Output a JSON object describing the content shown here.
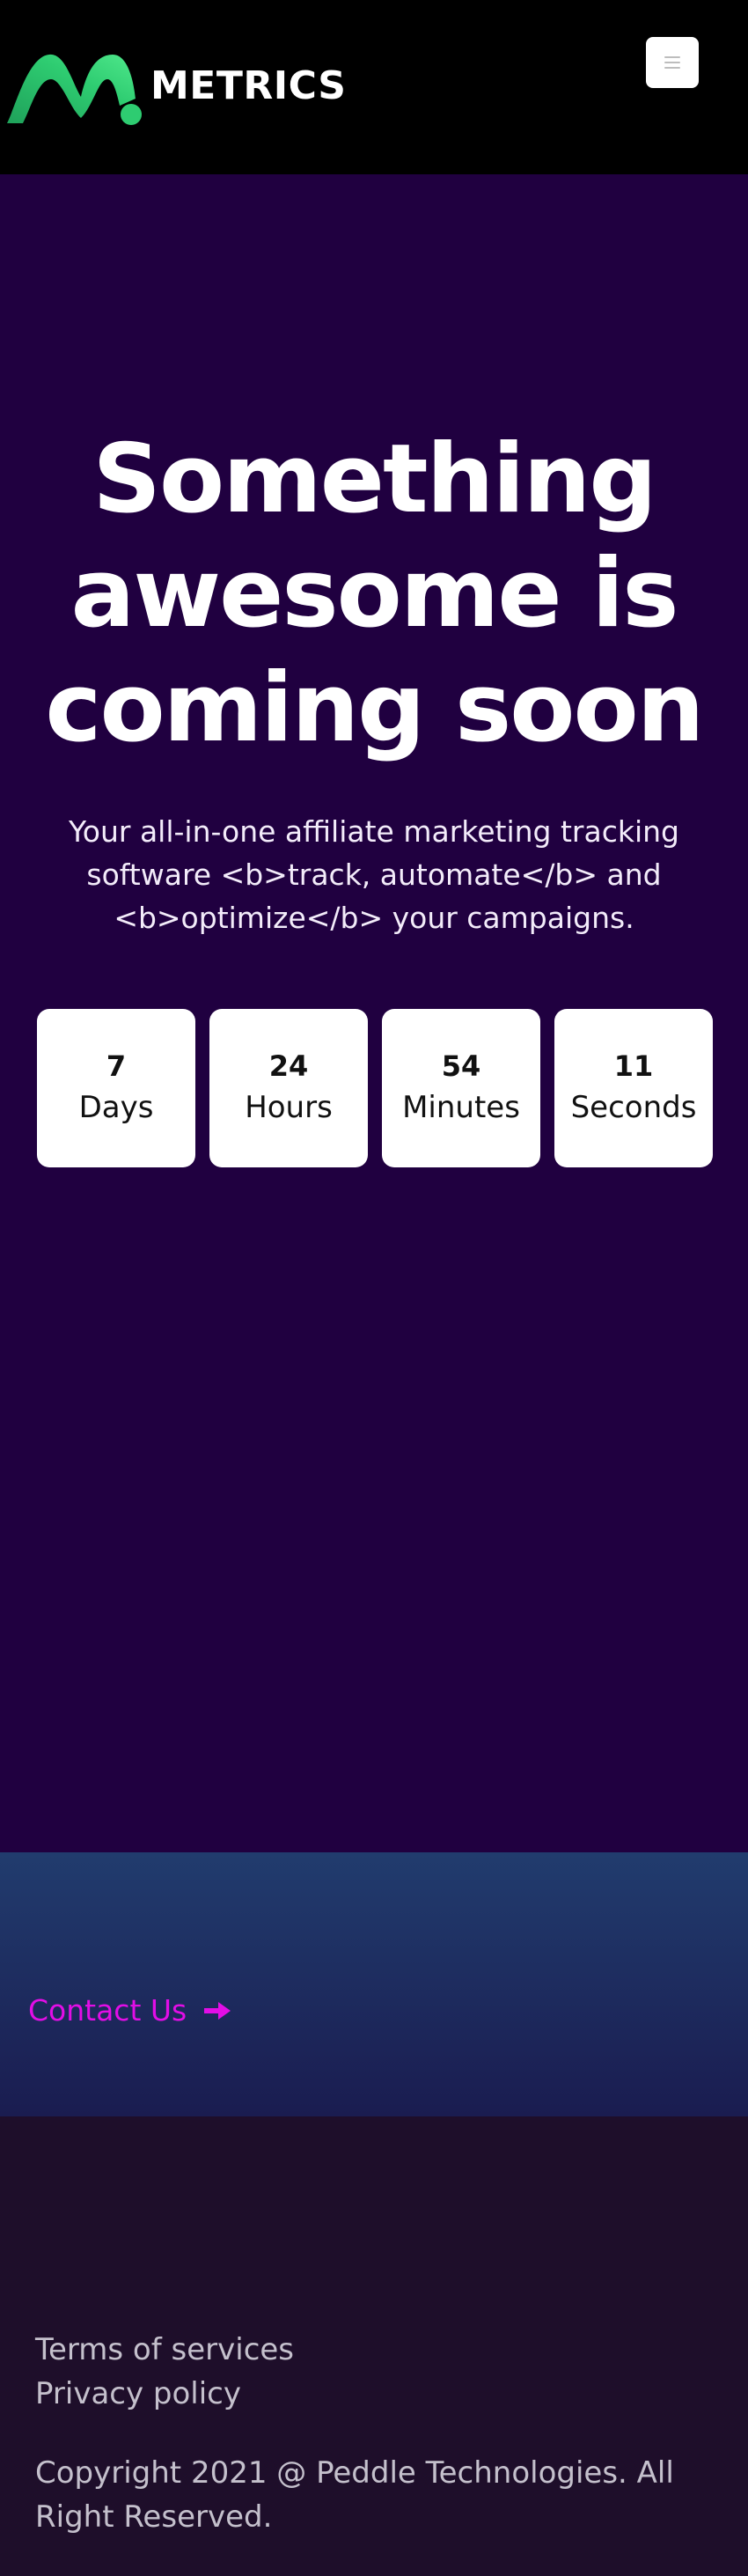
{
  "header": {
    "logo_text": "METRICS",
    "menu_icon": "hamburger-icon"
  },
  "hero": {
    "title": "Something awesome is coming soon",
    "subtitle": "Your all-in-one affiliate marketing tracking software <b>track, automate</b> and <b>optimize</b> your campaigns."
  },
  "countdown": [
    {
      "value": "7",
      "label": "Days"
    },
    {
      "value": "24",
      "label": "Hours"
    },
    {
      "value": "54",
      "label": "Minutes"
    },
    {
      "value": "11",
      "label": "Seconds"
    }
  ],
  "contact": {
    "label": "Contact Us",
    "icon": "arrow-right-icon",
    "color": "#e20ee6"
  },
  "footer": {
    "terms_label": "Terms of services",
    "privacy_label": "Privacy policy",
    "copyright": "Copyright 2021 @ Peddle Technologies. All Right Reserved."
  },
  "colors": {
    "header_bg": "#000000",
    "hero_bg": "#200040",
    "logo_green": "#2ecc71",
    "footer_bg": "#1e0e2a"
  }
}
